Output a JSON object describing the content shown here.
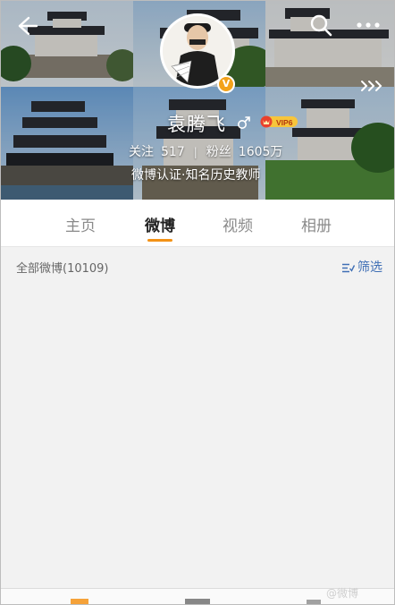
{
  "profile": {
    "username": "袁腾飞",
    "vip_label": "VIP6",
    "verified_mark": "V",
    "following_label": "关注",
    "following_count": "517",
    "followers_label": "粉丝",
    "followers_count": "1605万",
    "separator": "|",
    "verification": "微博认证·知名历史教师"
  },
  "tabs": [
    "主页",
    "微博",
    "视频",
    "相册"
  ],
  "active_tab": "微博",
  "feed": {
    "count_label": "全部微博(10109)",
    "filter_label": "筛选"
  },
  "watermark": "@微博",
  "icons": {
    "back": "back-arrow-icon",
    "search": "search-icon",
    "more": "more-icon",
    "expand": "chevron-right-icon",
    "gender": "male-icon",
    "filter": "filter-icon"
  },
  "colors": {
    "accent": "#f39216",
    "filter_blue": "#3f6fb5",
    "badge_orange": "#f3a21a"
  }
}
